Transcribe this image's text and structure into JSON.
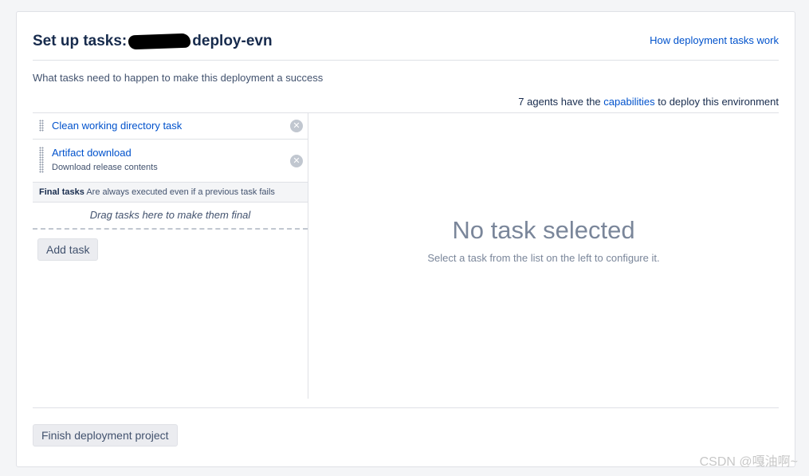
{
  "header": {
    "title_prefix": "Set up tasks:",
    "title_suffix": "deploy-evn",
    "help_link": "How deployment tasks work"
  },
  "subtitle": "What tasks need to happen to make this deployment a success",
  "agents": {
    "prefix": "7 agents have the",
    "link": "capabilities",
    "suffix": "to deploy this environment"
  },
  "tasks": [
    {
      "name": "Clean working directory task",
      "description": ""
    },
    {
      "name": "Artifact download",
      "description": "Download release contents"
    }
  ],
  "final_tasks": {
    "label": "Final tasks",
    "note": "Are always executed even if a previous task fails",
    "drop_hint": "Drag tasks here to make them final"
  },
  "add_task_label": "Add task",
  "empty_state": {
    "title": "No task selected",
    "subtitle": "Select a task from the list on the left to configure it."
  },
  "finish_label": "Finish deployment project",
  "watermark": "CSDN @嘎油啊~"
}
